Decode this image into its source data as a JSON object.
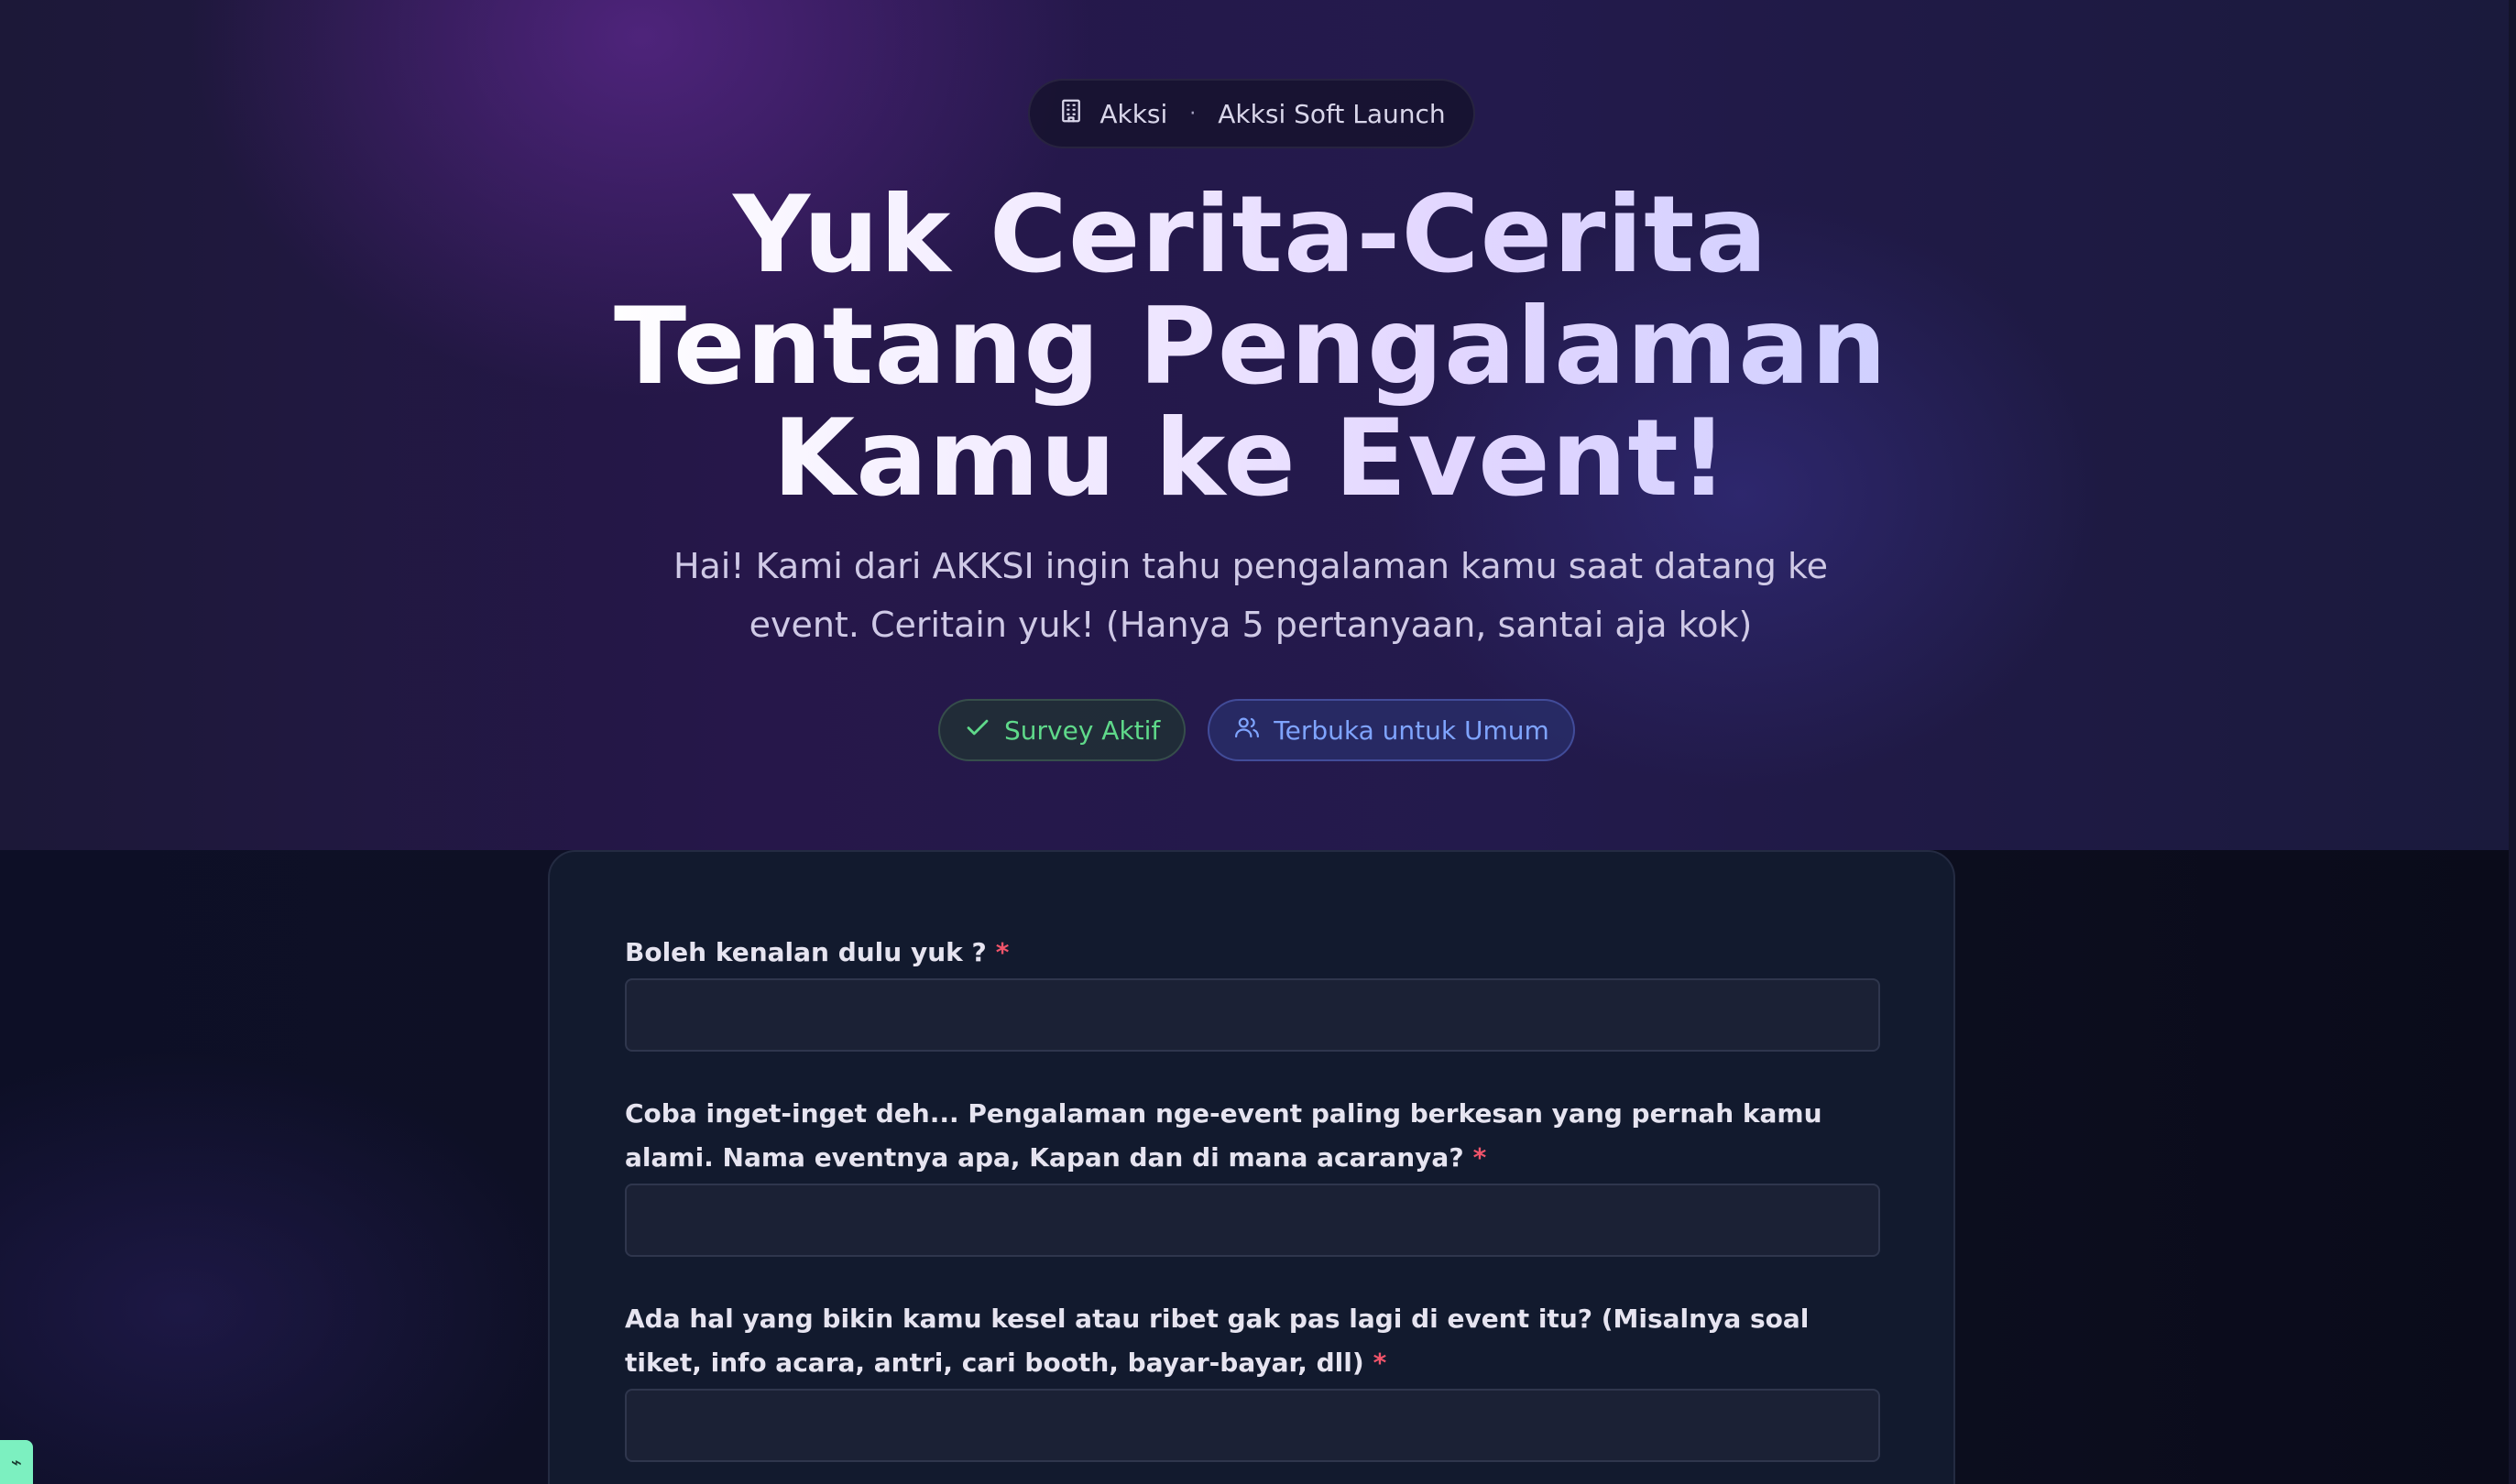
{
  "breadcrumb": {
    "org": "Akksi",
    "separator": "·",
    "event": "Akksi Soft Launch"
  },
  "hero": {
    "title_line1": "Yuk Cerita-Cerita",
    "title_line2": "Tentang Pengalaman",
    "title_line3": "Kamu ke Event!",
    "subtitle": "Hai! Kami dari AKKSI ingin tahu pengalaman kamu saat datang ke event. Ceritain yuk! (Hanya 5 pertanyaan, santai aja kok)"
  },
  "badges": {
    "status": "Survey Aktif",
    "access": "Terbuka untuk Umum"
  },
  "form": {
    "questions": [
      {
        "label": "Boleh kenalan dulu yuk ?",
        "required_mark": "*",
        "value": ""
      },
      {
        "label": "Coba inget-inget deh... Pengalaman nge-event paling berkesan yang pernah kamu alami. Nama eventnya apa, Kapan dan di mana acaranya?",
        "required_mark": "*",
        "value": ""
      },
      {
        "label": "Ada hal yang bikin kamu kesel atau ribet gak pas lagi di event itu? (Misalnya soal tiket, info acara, antri, cari booth, bayar-bayar, dll)",
        "required_mark": "*",
        "value": ""
      }
    ]
  },
  "colors": {
    "accent_green": "#5fd98a",
    "accent_blue": "#7fa4ff",
    "required_red": "#f0546a"
  }
}
